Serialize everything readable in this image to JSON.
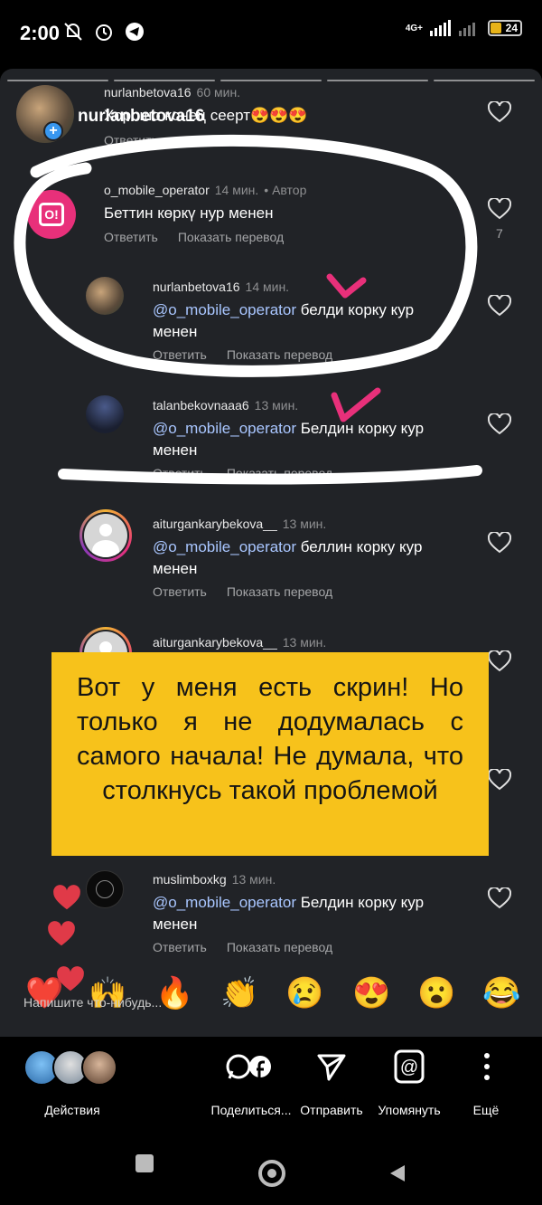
{
  "status_bar": {
    "time": "2:00",
    "network": "4G+",
    "battery": "24"
  },
  "comments": [
    {
      "username": "nurlanbetova16",
      "time": "60 мин.",
      "text": "Хорошо конец сеерт😍😍😍",
      "reply_label": "Ответить",
      "overlay_username": "nurlanbetova16"
    },
    {
      "username": "o_mobile_operator",
      "time": "14 мин.",
      "author_badge": "• Автор",
      "text": "Беттин көркү нур менен",
      "reply_label": "Ответить",
      "translate_label": "Показать перевод",
      "likes": "7"
    },
    {
      "username": "nurlanbetova16",
      "time": "14 мин.",
      "mention": "@o_mobile_operator",
      "text": " белди корку кур менен",
      "reply_label": "Ответить",
      "translate_label": "Показать перевод"
    },
    {
      "username": "talanbekovnaaa6",
      "time": "13 мин.",
      "mention": "@o_mobile_operator",
      "text": " Белдин корку кур менен",
      "reply_label": "Ответить",
      "translate_label": "Показать перевод"
    },
    {
      "username": "aiturgankarybekova__",
      "time": "13 мин.",
      "mention": "@o_mobile_operator",
      "text": " беллин корку кур менен",
      "reply_label": "Ответить",
      "translate_label": "Показать перевод"
    },
    {
      "username": "aiturgankarybekova__",
      "time": "13 мин."
    },
    {
      "username": "muslimboxkg",
      "time": "13 мин.",
      "mention": "@o_mobile_operator",
      "text": " Белдин корку кур менен",
      "reply_label": "Ответить",
      "translate_label": "Показать перевод"
    }
  ],
  "overlay_note": "Вот у меня есть скрин! Но только я не додумалась с самого начала! Не думала, что столкнусь такой проблемой",
  "emoji_bar": [
    "❤️",
    "🙌",
    "🔥",
    "👏",
    "😢",
    "😍",
    "😮",
    "😂"
  ],
  "input_placeholder": "Напишите что-нибудь...",
  "bottom_actions": {
    "activity": "Действия",
    "share": "Поделиться...",
    "send": "Отправить",
    "mention": "Упомянуть",
    "more": "Ещё"
  },
  "colors": {
    "sheet_bg": "#212327",
    "mention": "#a9c6ff",
    "note_bg": "#f7c21b",
    "brand_pink": "#e8307a"
  }
}
